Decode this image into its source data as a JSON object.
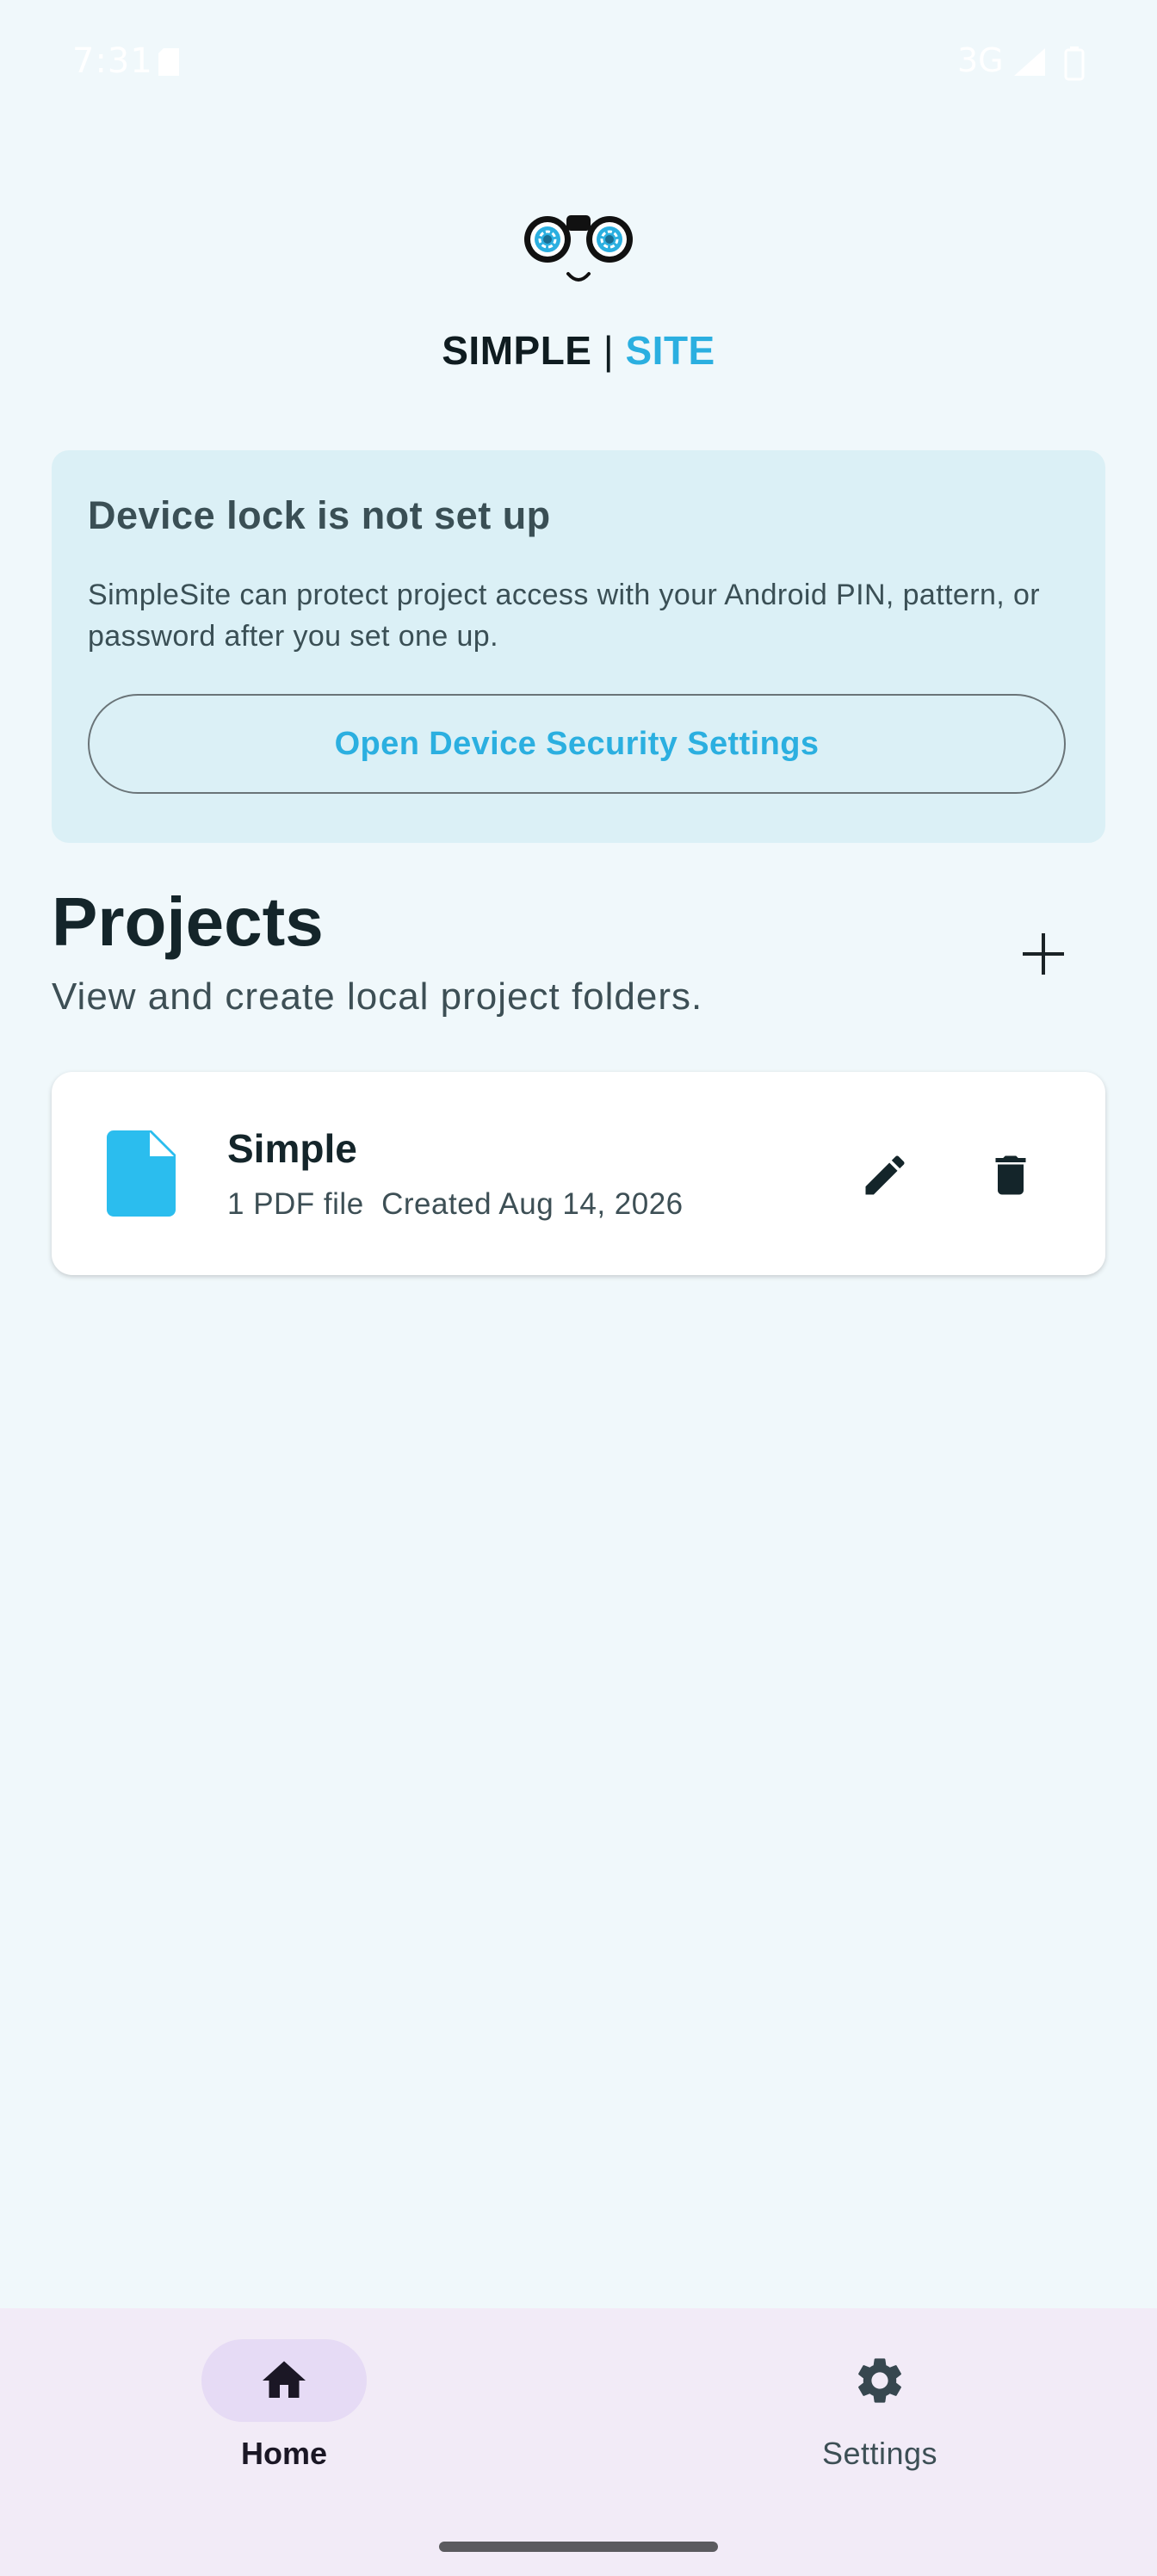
{
  "status_bar": {
    "time": "7:31",
    "network": "3G",
    "icons": [
      "sd-card-icon",
      "signal-icon",
      "battery-icon"
    ]
  },
  "brand": {
    "simple": "SIMPLE",
    "separator": " | ",
    "site": "SITE",
    "logo_icon": "binoculars-glasses-logo",
    "accent_color": "#2bafe0"
  },
  "device_lock_card": {
    "title": "Device lock is not set up",
    "description": "SimpleSite can protect project access with your Android PIN, pattern, or password after you set one up.",
    "button_label": "Open Device Security Settings"
  },
  "projects": {
    "title": "Projects",
    "subtitle": "View and create local project folders.",
    "add_icon": "plus-icon",
    "items": [
      {
        "name": "Simple",
        "meta": "1 PDF file  Created Aug 14, 2026",
        "icon": "file-icon",
        "actions": [
          "edit-icon",
          "delete-icon"
        ]
      }
    ]
  },
  "bottom_nav": {
    "items": [
      {
        "label": "Home",
        "icon": "home-icon",
        "selected": true
      },
      {
        "label": "Settings",
        "icon": "gear-icon",
        "selected": false
      }
    ]
  }
}
